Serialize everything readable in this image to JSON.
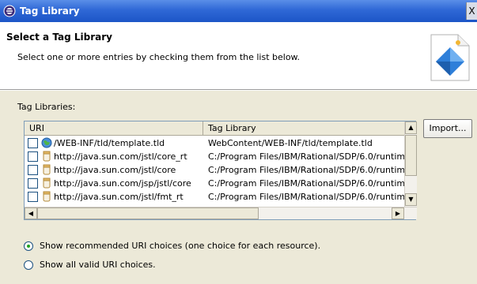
{
  "window": {
    "title": "Tag Library",
    "close_glyph": "X",
    "title_icon": "eclipse-icon"
  },
  "header": {
    "title": "Select a Tag Library",
    "description": "Select one or more entries by checking them from the list below.",
    "banner_icon": "wizard-diamond-icon"
  },
  "tag_libraries": {
    "label": "Tag Libraries:",
    "columns": [
      "URI",
      "Tag Library"
    ],
    "rows": [
      {
        "uri": "/WEB-INF/tld/template.tld",
        "tag_library": "WebContent/WEB-INF/tld/template.tld",
        "icon": "globe-icon",
        "checked": false
      },
      {
        "uri": "http://java.sun.com/jstl/core_rt",
        "tag_library": "C:/Program Files/IBM/Rational/SDP/6.0/runtim",
        "icon": "jar-icon",
        "checked": false
      },
      {
        "uri": "http://java.sun.com/jstl/core",
        "tag_library": "C:/Program Files/IBM/Rational/SDP/6.0/runtim",
        "icon": "jar-icon",
        "checked": false
      },
      {
        "uri": "http://java.sun.com/jsp/jstl/core",
        "tag_library": "C:/Program Files/IBM/Rational/SDP/6.0/runtim",
        "icon": "jar-icon",
        "checked": false
      },
      {
        "uri": "http://java.sun.com/jstl/fmt_rt",
        "tag_library": "C:/Program Files/IBM/Rational/SDP/6.0/runtim",
        "icon": "jar-icon",
        "checked": false
      }
    ]
  },
  "buttons": {
    "import": "Import..."
  },
  "options": {
    "recommended": "Show recommended URI choices (one choice for each resource).",
    "all_valid": "Show all valid URI choices.",
    "selected": "recommended"
  }
}
